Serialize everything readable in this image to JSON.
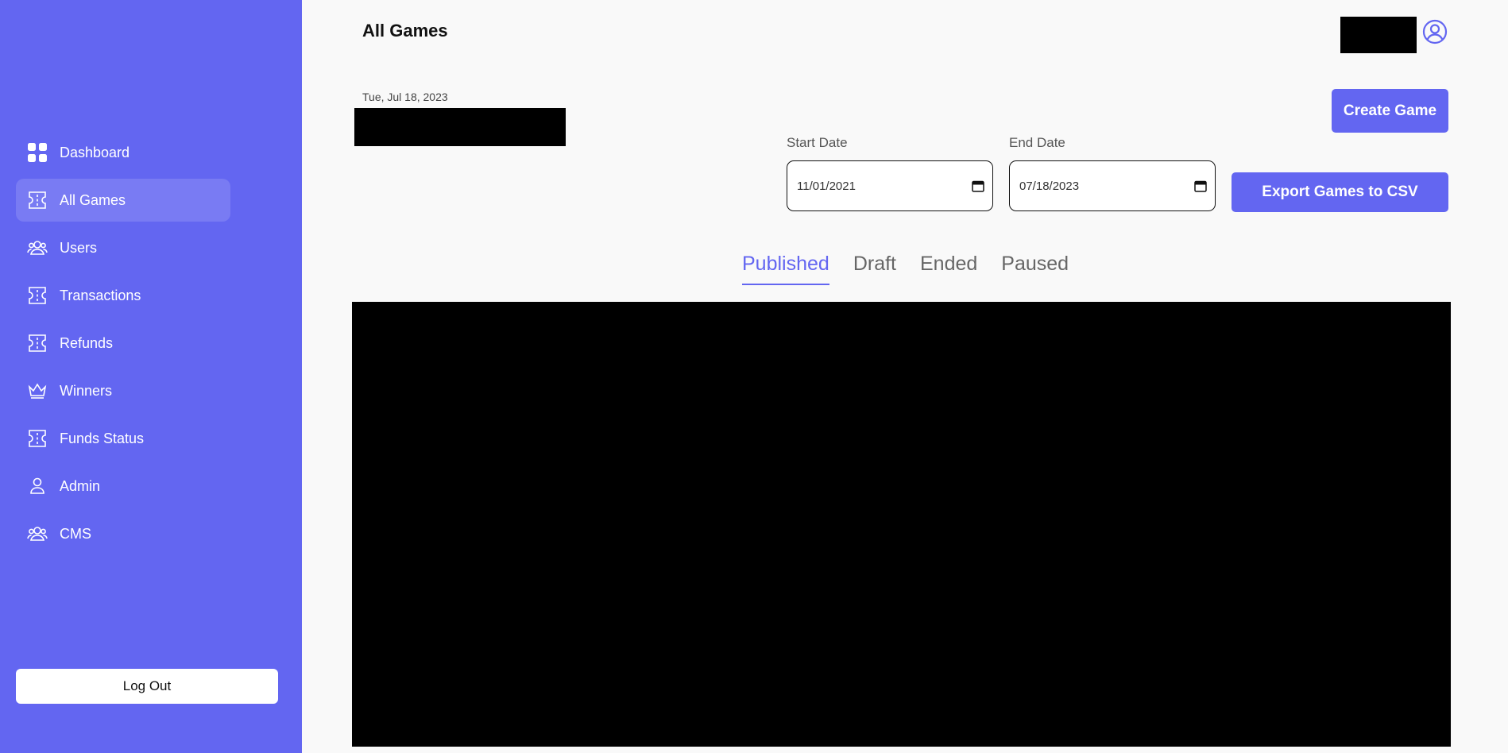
{
  "sidebar": {
    "items": [
      {
        "label": "Dashboard",
        "icon": "grid-icon",
        "active": false
      },
      {
        "label": "All Games",
        "icon": "ticket-icon",
        "active": true
      },
      {
        "label": "Users",
        "icon": "users-icon",
        "active": false
      },
      {
        "label": "Transactions",
        "icon": "ticket-icon",
        "active": false
      },
      {
        "label": "Refunds",
        "icon": "ticket-icon",
        "active": false
      },
      {
        "label": "Winners",
        "icon": "crown-icon",
        "active": false
      },
      {
        "label": "Funds Status",
        "icon": "ticket-icon",
        "active": false
      },
      {
        "label": "Admin",
        "icon": "user-icon",
        "active": false
      },
      {
        "label": "CMS",
        "icon": "users-icon",
        "active": false
      }
    ],
    "logout_label": "Log Out",
    "color": "#6366f1"
  },
  "header": {
    "title": "All Games",
    "profile_icon": "user-circle-icon"
  },
  "main": {
    "date": "Tue, Jul 18, 2023",
    "create_label": "Create Game",
    "export_label": "Export Games to CSV",
    "start_label": "Start Date",
    "start_value": "11/01/2021",
    "end_label": "End Date",
    "end_value": "07/18/2023",
    "tabs": [
      {
        "label": "Published",
        "active": true
      },
      {
        "label": "Draft",
        "active": false
      },
      {
        "label": "Ended",
        "active": false
      },
      {
        "label": "Paused",
        "active": false
      }
    ]
  }
}
